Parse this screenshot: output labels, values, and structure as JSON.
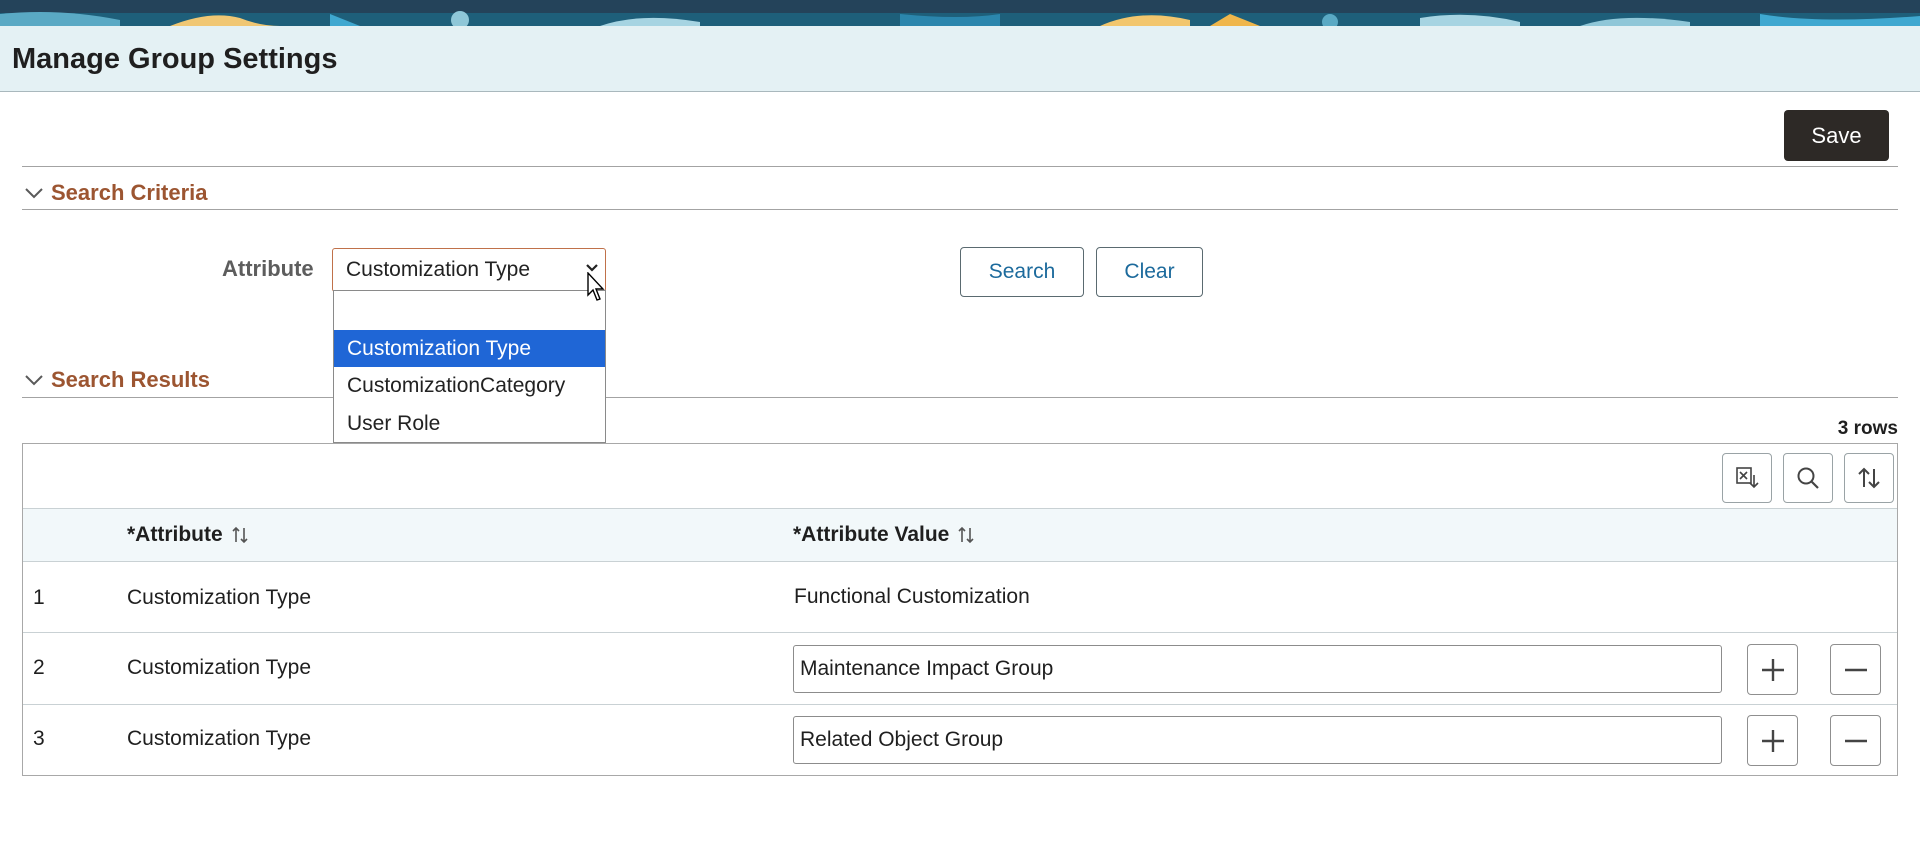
{
  "header": {
    "title": "Manage Group Settings"
  },
  "toolbar": {
    "save_label": "Save"
  },
  "search_criteria": {
    "title": "Search Criteria",
    "attribute_label": "Attribute",
    "attribute_value": "Customization Type",
    "search_label": "Search",
    "clear_label": "Clear",
    "dropdown": {
      "options": [
        "",
        "Customization Type",
        "CustomizationCategory",
        "User Role"
      ],
      "selected": "Customization Type"
    }
  },
  "search_results": {
    "title": "Search Results",
    "row_count": "3 rows",
    "columns": [
      "*Attribute",
      "*Attribute Value"
    ],
    "rows": [
      {
        "num": "1",
        "attribute": "Customization Type",
        "value": "Functional Customization",
        "editable": false
      },
      {
        "num": "2",
        "attribute": "Customization Type",
        "value": "Maintenance Impact Group",
        "editable": true
      },
      {
        "num": "3",
        "attribute": "Customization Type",
        "value": "Related Object Group",
        "editable": true
      }
    ]
  },
  "colors": {
    "accent": "#9c5531",
    "primary_button": "#2d2926",
    "link": "#1c6a9c",
    "selected_option": "#1f66d6",
    "header_bg": "#e4f1f4"
  }
}
